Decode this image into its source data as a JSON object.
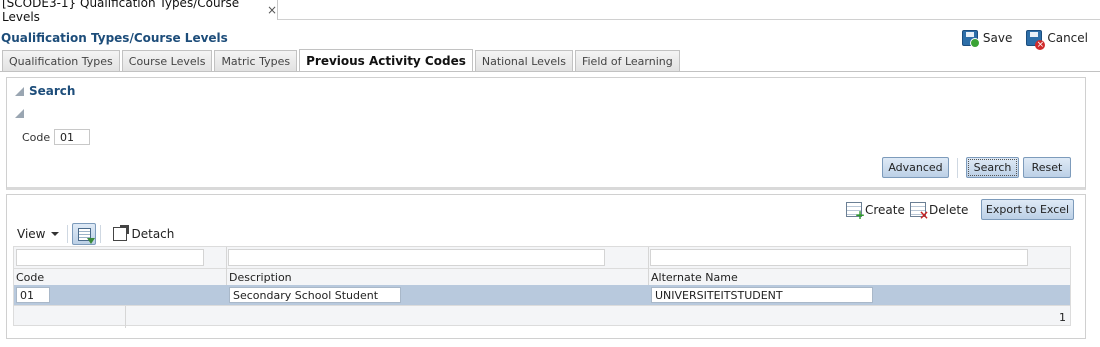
{
  "document_tab": {
    "title": "[SCODE3-1} Qualification Types/Course Levels",
    "close": "×"
  },
  "page": {
    "title": "Qualification Types/Course Levels"
  },
  "actions": {
    "save": "Save",
    "cancel": "Cancel"
  },
  "tabs": [
    {
      "label": "Qualification Types",
      "active": false
    },
    {
      "label": "Course Levels",
      "active": false
    },
    {
      "label": "Matric Types",
      "active": false
    },
    {
      "label": "Previous Activity Codes",
      "active": true
    },
    {
      "label": "National Levels",
      "active": false
    },
    {
      "label": "Field of Learning",
      "active": false
    }
  ],
  "search": {
    "heading": "Search",
    "code_label": "Code",
    "code_value": "01",
    "advanced": "Advanced",
    "search": "Search",
    "reset": "Reset"
  },
  "results": {
    "create": "Create",
    "delete": "Delete",
    "export": "Export to Excel",
    "view": "View",
    "detach": "Detach",
    "columns": [
      "Code",
      "Description",
      "Alternate Name"
    ],
    "rows": [
      {
        "code": "01",
        "description": "Secondary School Student",
        "alternate_name": "UNIVERSITEITSTUDENT"
      }
    ],
    "row_count": "1"
  },
  "colors": {
    "accent": "#1d4d7a",
    "selected_row": "#b8c9dd",
    "button": "#bcd0e6"
  }
}
